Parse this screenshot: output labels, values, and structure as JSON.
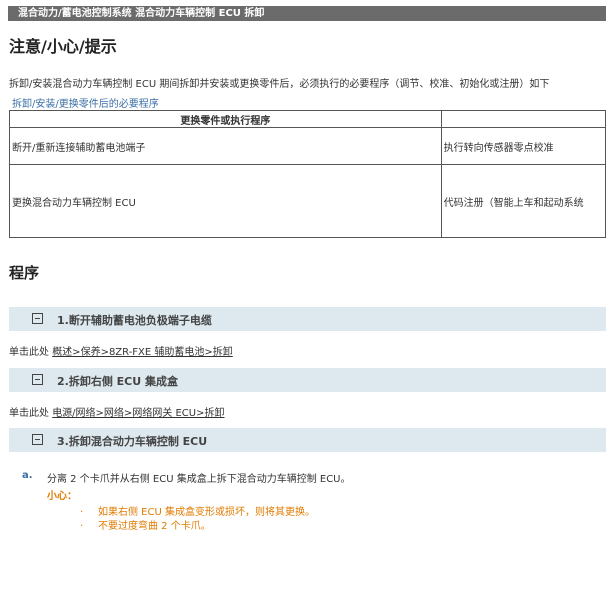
{
  "breadcrumb": "混合动力/蓄电池控制系统  混合动力车辆控制 ECU  拆卸",
  "title": "注意/小心/提示",
  "intro": "拆卸/安装混合动力车辆控制 ECU 期间拆卸并安装或更换零件后，必须执行的必要程序（调节、校准、初始化或注册）如下",
  "sublink": "拆卸/安装/更换零件后的必要程序",
  "table": {
    "header": [
      "更换零件或执行程序",
      ""
    ],
    "rows": [
      [
        "断开/重新连接辅助蓄电池端子",
        "执行转向传感器零点校准"
      ],
      [
        "更换混合动力车辆控制 ECU",
        "代码注册（智能上车和起动系统"
      ]
    ]
  },
  "procedure_title": "程序",
  "steps": [
    {
      "label": "1.断开辅助蓄电池负极端子电缆",
      "click_prefix": "单击此处",
      "click_link": "概述>保养>8ZR-FXE 辅助蓄电池>拆卸"
    },
    {
      "label": "2.拆卸右侧 ECU 集成盒",
      "click_prefix": "单击此处",
      "click_link": "电源/网络>网络>网络网关 ECU>拆卸"
    },
    {
      "label": "3.拆卸混合动力车辆控制 ECU"
    }
  ],
  "substep": {
    "letter": "a.",
    "text": "分离 2 个卡爪并从右侧 ECU 集成盒上拆下混合动力车辆控制 ECU。",
    "caution_label": "小心：",
    "bullets": [
      "如果右侧 ECU 集成盒变形或损坏，则将其更换。",
      "不要过度弯曲 2 个卡爪。"
    ]
  },
  "colors": {
    "topbar": "#6b6b6b",
    "step_bg": "#dde9ee",
    "link_blue": "#3a6ea5",
    "caution": "#e07b00"
  }
}
